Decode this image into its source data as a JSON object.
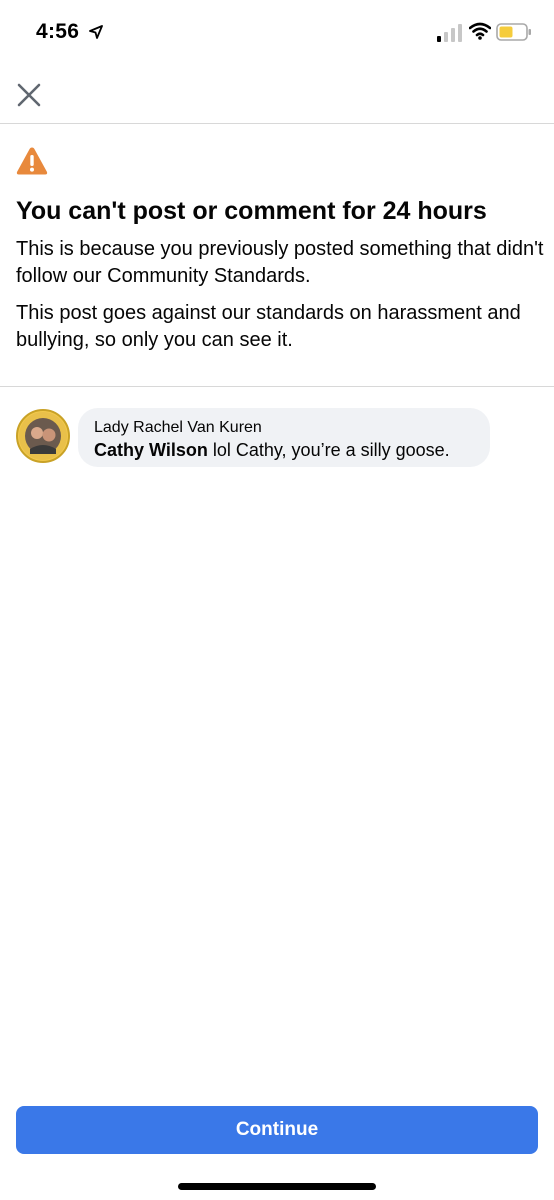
{
  "status_bar": {
    "time": "4:56",
    "icons": [
      "location-arrow-icon",
      "cellular-signal-icon",
      "wifi-icon",
      "battery-icon"
    ]
  },
  "header": {
    "close_icon": "close-icon"
  },
  "warning": {
    "icon": "warning-icon",
    "icon_color": "#E8893C",
    "title": "You can't post or comment for 24 hours",
    "body": "This is because you previously posted something that didn't follow our Community Standards.",
    "detail": "This post goes against our standards on harassment and bullying, so only you can see it."
  },
  "comment": {
    "avatar": "avatar",
    "author": "Lady Rachel Van Kuren",
    "mention": "Cathy Wilson",
    "text": " lol Cathy, you’re a silly goose."
  },
  "footer": {
    "continue_label": "Continue",
    "button_color": "#3A78E8"
  }
}
